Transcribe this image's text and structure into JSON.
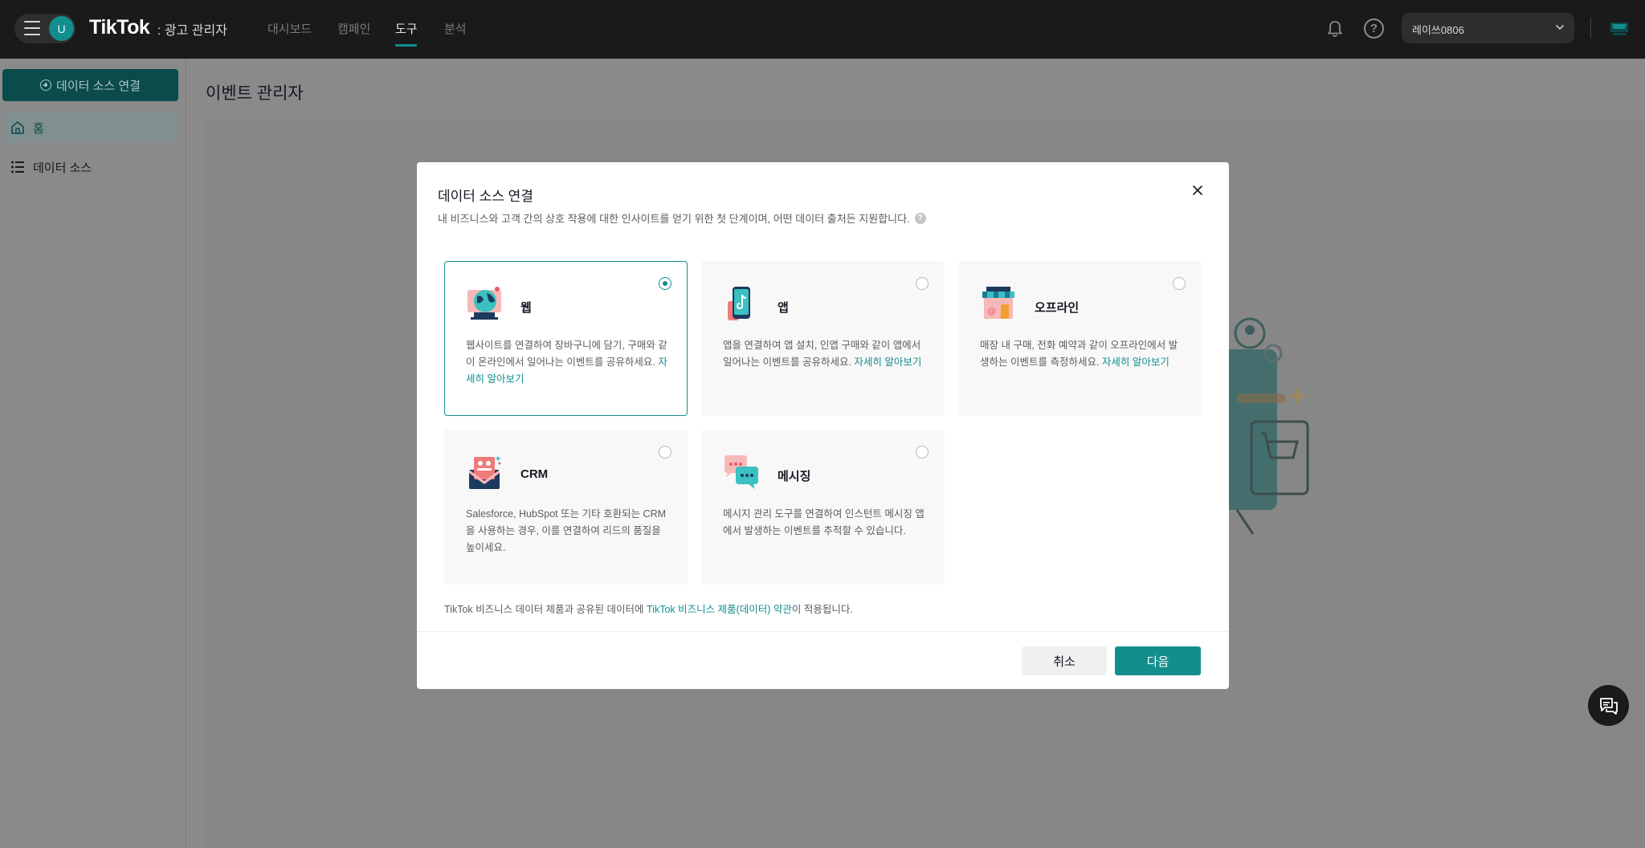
{
  "header": {
    "avatar_letter": "U",
    "logo": "TikTok",
    "logo_sub": ": 광고 관리자",
    "nav": [
      {
        "label": "대시보드",
        "active": false
      },
      {
        "label": "캠페인",
        "active": false
      },
      {
        "label": "도구",
        "active": true
      },
      {
        "label": "분석",
        "active": false
      }
    ],
    "account_name": "레이쓰0806",
    "help_glyph": "?"
  },
  "sidebar": {
    "connect_button": "데이터 소스 연결",
    "items": [
      {
        "label": "홈",
        "icon": "home-icon",
        "active": true
      },
      {
        "label": "데이터 소스",
        "icon": "list-icon",
        "active": false
      }
    ]
  },
  "page": {
    "title": "이벤트 관리자"
  },
  "modal": {
    "title": "데이터 소스 연결",
    "subtitle": "내 비즈니스와 고객 간의 상호 작용에 대한 인사이트를 얻기 위한 첫 단계이며, 어떤 데이터 출처든 지원합니다.",
    "help_glyph": "?",
    "cards": [
      {
        "title": "웹",
        "icon": "web-globe-icon",
        "selected": true,
        "desc": "웹사이트를 연결하여 장바구니에 담기, 구매와 같이 온라인에서 일어나는 이벤트를 공유하세요.",
        "link": "자세히 알아보기"
      },
      {
        "title": "앱",
        "icon": "app-phone-icon",
        "selected": false,
        "desc": "앱을 연결하여 앱 설치, 인앱 구매와 같이 앱에서 일어나는 이벤트를 공유하세요.",
        "link": "자세히 알아보기"
      },
      {
        "title": "오프라인",
        "icon": "offline-store-icon",
        "selected": false,
        "desc": "매장 내 구매, 전화 예약과 같이 오프라인에서 발생하는 이벤트를 측정하세요.",
        "link": "자세히 알아보기"
      },
      {
        "title": "CRM",
        "icon": "crm-envelope-icon",
        "selected": false,
        "desc": "Salesforce, HubSpot 또는 기타 호환되는 CRM을 사용하는 경우, 이를 연결하여 리드의 품질을 높이세요.",
        "link": ""
      },
      {
        "title": "메시징",
        "icon": "messaging-bubbles-icon",
        "selected": false,
        "desc": "메시지 관리 도구를 연결하여 인스턴트 메시징 앱에서 발생하는 이벤트를 추적할 수 있습니다.",
        "link": ""
      }
    ],
    "terms_prefix": "TikTok 비즈니스 데이터 제품과 공유된 데이터에 ",
    "terms_link": "TikTok 비즈니스 제품(데이터) 약관",
    "terms_suffix": "이 적용됩니다.",
    "cancel": "취소",
    "next": "다음"
  },
  "colors": {
    "accent": "#138e8e",
    "topbar": "#1a1a1a",
    "overlay_bg": "#8a8a8a"
  }
}
